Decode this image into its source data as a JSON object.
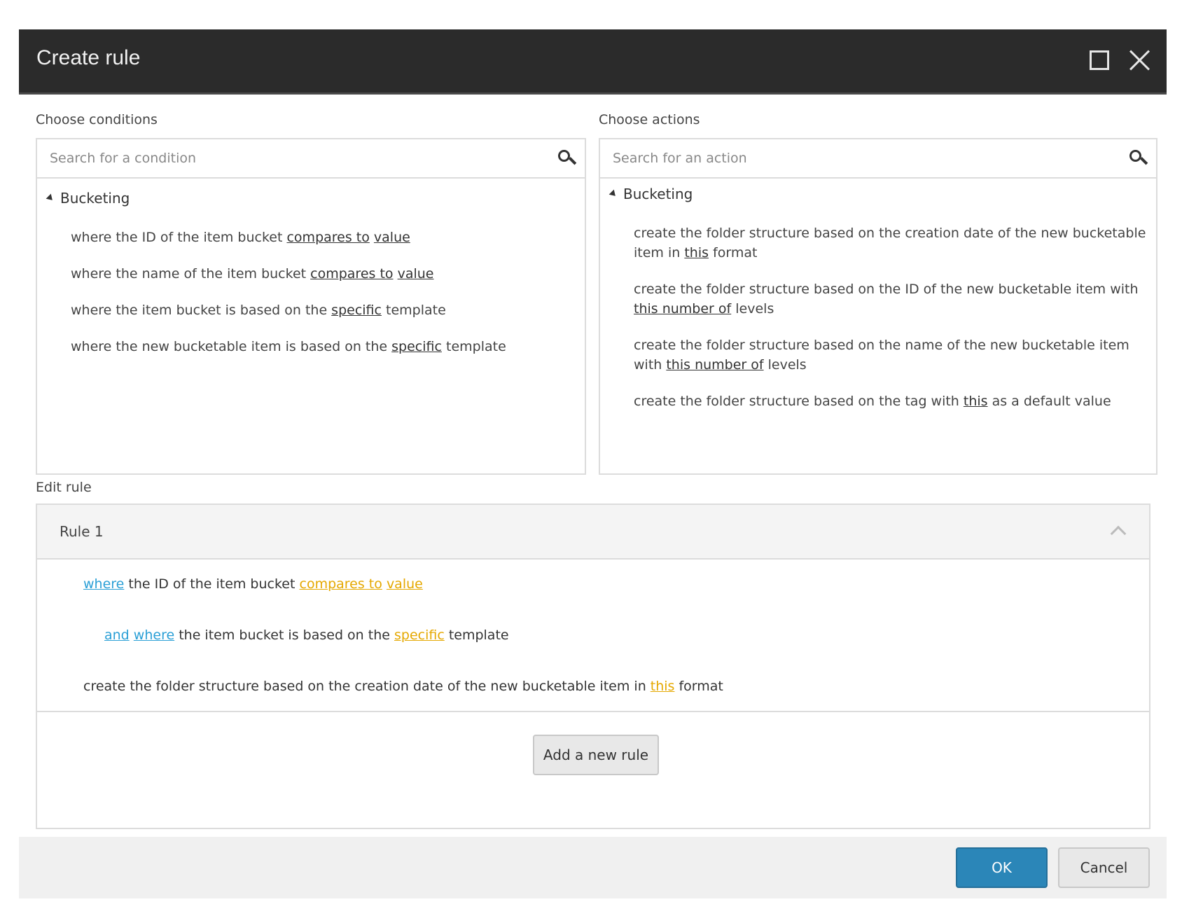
{
  "dialog": {
    "title": "Create rule"
  },
  "conditions": {
    "label": "Choose conditions",
    "search_placeholder": "Search for a condition",
    "group": "Bucketing",
    "items": [
      {
        "pre": "where the ID of the item bucket ",
        "l1": "compares to",
        "mid": " ",
        "l2": "value",
        "post": ""
      },
      {
        "pre": "where the name of the item bucket ",
        "l1": "compares to",
        "mid": " ",
        "l2": "value",
        "post": ""
      },
      {
        "pre": "where the item bucket is based on the ",
        "l1": "specific",
        "post": " template"
      },
      {
        "pre": "where the new bucketable item is based on the ",
        "l1": "specific",
        "post": " template"
      }
    ]
  },
  "actions": {
    "label": "Choose actions",
    "search_placeholder": "Search for an action",
    "group": "Bucketing",
    "items": [
      {
        "pre": "create the folder structure based on the creation date of the new bucketable item in ",
        "l1": "this",
        "post": " format"
      },
      {
        "pre": "create the folder structure based on the ID of the new bucketable item with ",
        "l1": "this number of",
        "post": " levels"
      },
      {
        "pre": "create the folder structure based on the name of the new bucketable item with ",
        "l1": "this number of",
        "post": " levels"
      },
      {
        "pre": "create the folder structure based on the tag with ",
        "l1": "this",
        "post": " as a default value"
      }
    ]
  },
  "edit_rule": {
    "label": "Edit rule",
    "rule_title": "Rule 1",
    "line1": {
      "kw": "where",
      "t1": " the ID of the item bucket ",
      "p1": "compares to",
      "sp": " ",
      "p2": "value"
    },
    "line2": {
      "kw1": "and",
      "sp": " ",
      "kw2": "where",
      "t1": " the item bucket is based on the ",
      "p1": "specific",
      "t2": " template"
    },
    "line3": {
      "t1": "create the folder structure based on the creation date of the new bucketable item in ",
      "p1": "this",
      "t2": " format"
    },
    "add_rule_label": "Add a new rule"
  },
  "footer": {
    "ok_label": "OK",
    "cancel_label": "Cancel"
  },
  "colors": {
    "titlebar": "#2b2b2b",
    "keyword": "#2a9fd6",
    "parameter": "#e5a800",
    "primary_button": "#2b86b8"
  }
}
